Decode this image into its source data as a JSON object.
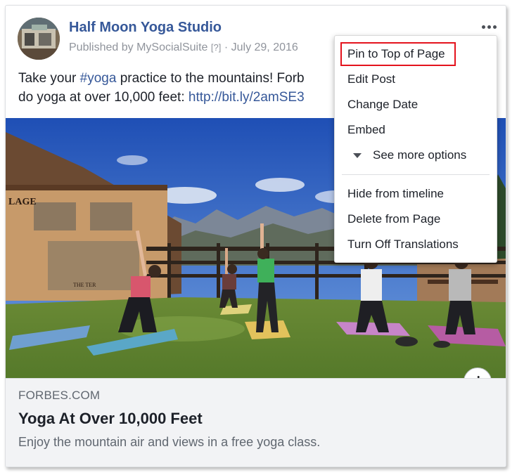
{
  "post": {
    "page_name": "Half Moon Yoga Studio",
    "published_by_prefix": "Published by",
    "publisher": "MySocialSuite",
    "help_marker": "[?]",
    "separator": "·",
    "date": "July 29, 2016",
    "text_line1_a": "Take your ",
    "hashtag": "#yoga",
    "text_line1_b": " practice to the mountains! Forb",
    "text_line2_a": "do yoga at over 10,000 feet: ",
    "url": "http://bit.ly/2amSE3"
  },
  "image": {
    "building_sign": "LAGE",
    "building_sign2": "THE TER"
  },
  "link_preview": {
    "domain": "FORBES.COM",
    "title": "Yoga At Over 10,000 Feet",
    "description": "Enjoy the mountain air and views in a free yoga class.",
    "info_glyph": "i"
  },
  "menu": {
    "items": [
      {
        "label": "Pin to Top of Page"
      },
      {
        "label": "Edit Post"
      },
      {
        "label": "Change Date"
      },
      {
        "label": "Embed"
      },
      {
        "label": "See more options"
      },
      {
        "label": "Hide from timeline"
      },
      {
        "label": "Delete from Page"
      },
      {
        "label": "Turn Off Translations"
      }
    ],
    "highlight_color": "#e4131d"
  },
  "colors": {
    "link_blue": "#365899",
    "meta_gray": "#90949c",
    "link_box_bg": "#f2f3f5"
  },
  "icons": {
    "more": "more-options-icon",
    "info": "info-icon",
    "expand": "triangle-down-icon"
  }
}
